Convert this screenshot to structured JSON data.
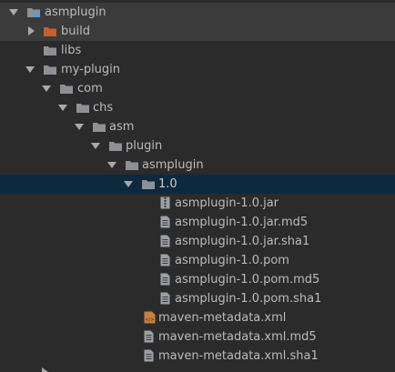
{
  "tree": {
    "asmplugin": "asmplugin",
    "build": "build",
    "libs": "libs",
    "my_plugin": "my-plugin",
    "com": "com",
    "chs": "chs",
    "asm": "asm",
    "plugin": "plugin",
    "asmplugin_dir": "asmplugin",
    "version": "1.0",
    "files": [
      "asmplugin-1.0.jar",
      "asmplugin-1.0.jar.md5",
      "asmplugin-1.0.jar.sha1",
      "asmplugin-1.0.pom",
      "asmplugin-1.0.pom.md5",
      "asmplugin-1.0.pom.sha1"
    ],
    "maven_files": [
      "maven-metadata.xml",
      "maven-metadata.xml.md5",
      "maven-metadata.xml.sha1"
    ]
  },
  "colors": {
    "background": "#2b2b2b",
    "text": "#bbbbbb",
    "folder": "#8d9196",
    "excluded_folder": "#c4602c",
    "selection": "#0d293e",
    "module": "#5a9bd5"
  }
}
